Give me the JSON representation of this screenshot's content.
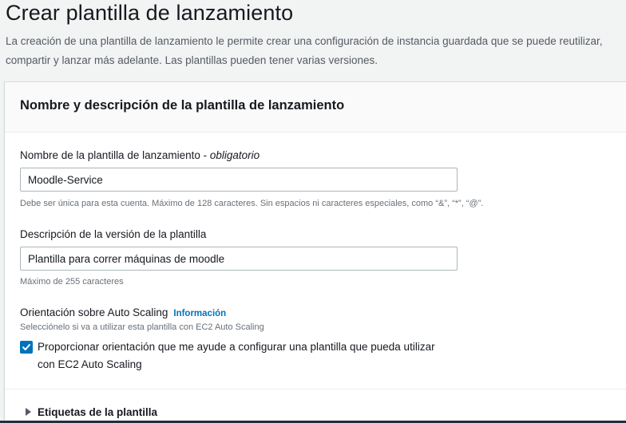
{
  "page": {
    "title": "Crear plantilla de lanzamiento",
    "description": "La creación de una plantilla de lanzamiento le permite crear una configuración de instancia guardada que se puede reutilizar, compartir y lanzar más adelante. Las plantillas pueden tener varias versiones."
  },
  "panel": {
    "title": "Nombre y descripción de la plantilla de lanzamiento",
    "name_field": {
      "label": "Nombre de la plantilla de lanzamiento - ",
      "label_required": "obligatorio",
      "value": "Moodle-Service",
      "hint": "Debe ser única para esta cuenta. Máximo de 128 caracteres. Sin espacios ni caracteres especiales, como “&”, “*”, “@”."
    },
    "description_field": {
      "label": "Descripción de la versión de la plantilla",
      "value": "Plantilla para correr máquinas de moodle",
      "hint": "Máximo de 255 caracteres"
    },
    "autoscaling": {
      "label": "Orientación sobre Auto Scaling",
      "info_link": "Información",
      "hint": "Selecciónelo si va a utilizar esta plantilla con EC2 Auto Scaling",
      "checkbox_label": "Proporcionar orientación que me ayude a configurar una plantilla que pueda utilizar con EC2 Auto Scaling",
      "checked": true
    },
    "tags_section": {
      "label": "Etiquetas de la plantilla",
      "expanded": false
    }
  },
  "colors": {
    "accent": "#0073bb",
    "background": "#f2f3f3",
    "text": "#16191f"
  }
}
